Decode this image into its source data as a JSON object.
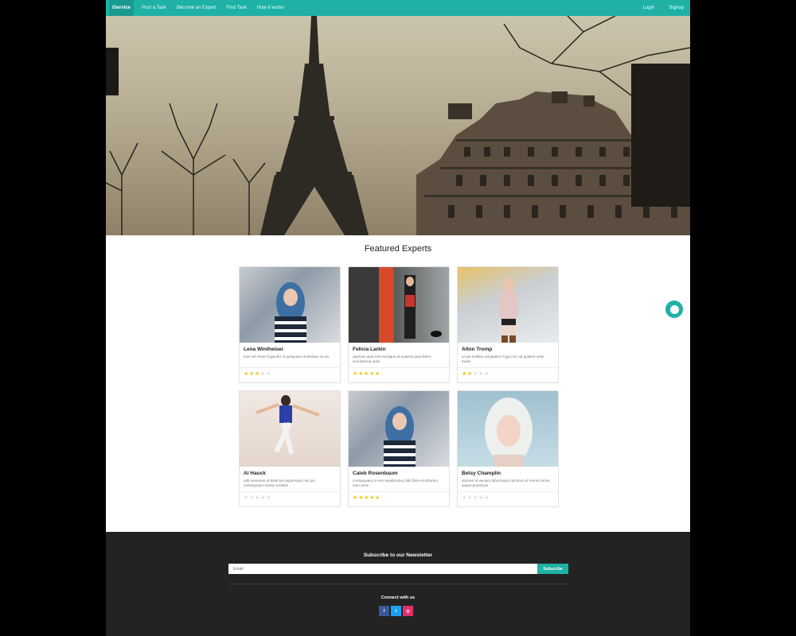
{
  "navbar": {
    "brand": "iService",
    "links": [
      "Post a Task",
      "Become an Expert",
      "Find Task",
      "How it works"
    ],
    "login": "Login",
    "signup": "Signup"
  },
  "featured": {
    "title": "Featured Experts",
    "experts": [
      {
        "name": "Lena Wintheiser",
        "description": "eius vel rerum fugia illo ut quisquam molestiae ea ea",
        "rating": 3,
        "max_rating": 5
      },
      {
        "name": "Felicia Larkin",
        "description": "aperiam quia eos similique id quaerat quia libero accusamus optio",
        "rating": 5,
        "max_rating": 5
      },
      {
        "name": "Alton Tromp",
        "description": "ut aut mollitia voluptatem fuga non ad quidem vitae facilis",
        "rating": 2,
        "max_rating": 5
      },
      {
        "name": "Al Hauck",
        "description": "odit inventore id delectus aspernatur nisi qui consequatur omnis veritatis",
        "rating": 0,
        "max_rating": 5
      },
      {
        "name": "Caleb Rosenbaum",
        "description": "consequatur in eos repellendus nihil illum et dolorum eum error",
        "rating": 5,
        "max_rating": 5
      },
      {
        "name": "Betsy Champlin",
        "description": "dolores ut veniam laboriosam ducimus et omnis minus saepe possimus",
        "rating": 0,
        "max_rating": 5
      }
    ]
  },
  "newsletter": {
    "title": "Subscribe to our Newsletter",
    "email_placeholder": "Email",
    "subscribe_label": "Subscribe"
  },
  "connect": {
    "title": "Connect with us",
    "social": [
      {
        "icon": "facebook-icon",
        "glyph": "f",
        "color": "#3b5998"
      },
      {
        "icon": "twitter-icon",
        "glyph": "t",
        "color": "#1da1f2"
      },
      {
        "icon": "instagram-icon",
        "glyph": "◎",
        "color": "#e1306c"
      }
    ]
  },
  "colors": {
    "accent": "#1fb1a5",
    "footer": "#232323",
    "star": "#f5c518"
  }
}
